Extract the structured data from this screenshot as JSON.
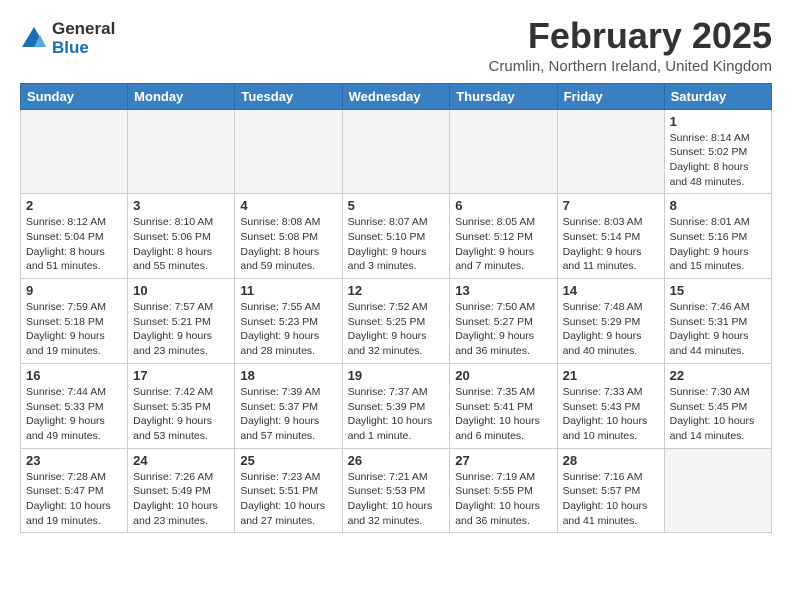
{
  "logo": {
    "general": "General",
    "blue": "Blue"
  },
  "title": "February 2025",
  "location": "Crumlin, Northern Ireland, United Kingdom",
  "days_of_week": [
    "Sunday",
    "Monday",
    "Tuesday",
    "Wednesday",
    "Thursday",
    "Friday",
    "Saturday"
  ],
  "weeks": [
    [
      {
        "num": "",
        "info": ""
      },
      {
        "num": "",
        "info": ""
      },
      {
        "num": "",
        "info": ""
      },
      {
        "num": "",
        "info": ""
      },
      {
        "num": "",
        "info": ""
      },
      {
        "num": "",
        "info": ""
      },
      {
        "num": "1",
        "info": "Sunrise: 8:14 AM\nSunset: 5:02 PM\nDaylight: 8 hours and 48 minutes."
      }
    ],
    [
      {
        "num": "2",
        "info": "Sunrise: 8:12 AM\nSunset: 5:04 PM\nDaylight: 8 hours and 51 minutes."
      },
      {
        "num": "3",
        "info": "Sunrise: 8:10 AM\nSunset: 5:06 PM\nDaylight: 8 hours and 55 minutes."
      },
      {
        "num": "4",
        "info": "Sunrise: 8:08 AM\nSunset: 5:08 PM\nDaylight: 8 hours and 59 minutes."
      },
      {
        "num": "5",
        "info": "Sunrise: 8:07 AM\nSunset: 5:10 PM\nDaylight: 9 hours and 3 minutes."
      },
      {
        "num": "6",
        "info": "Sunrise: 8:05 AM\nSunset: 5:12 PM\nDaylight: 9 hours and 7 minutes."
      },
      {
        "num": "7",
        "info": "Sunrise: 8:03 AM\nSunset: 5:14 PM\nDaylight: 9 hours and 11 minutes."
      },
      {
        "num": "8",
        "info": "Sunrise: 8:01 AM\nSunset: 5:16 PM\nDaylight: 9 hours and 15 minutes."
      }
    ],
    [
      {
        "num": "9",
        "info": "Sunrise: 7:59 AM\nSunset: 5:18 PM\nDaylight: 9 hours and 19 minutes."
      },
      {
        "num": "10",
        "info": "Sunrise: 7:57 AM\nSunset: 5:21 PM\nDaylight: 9 hours and 23 minutes."
      },
      {
        "num": "11",
        "info": "Sunrise: 7:55 AM\nSunset: 5:23 PM\nDaylight: 9 hours and 28 minutes."
      },
      {
        "num": "12",
        "info": "Sunrise: 7:52 AM\nSunset: 5:25 PM\nDaylight: 9 hours and 32 minutes."
      },
      {
        "num": "13",
        "info": "Sunrise: 7:50 AM\nSunset: 5:27 PM\nDaylight: 9 hours and 36 minutes."
      },
      {
        "num": "14",
        "info": "Sunrise: 7:48 AM\nSunset: 5:29 PM\nDaylight: 9 hours and 40 minutes."
      },
      {
        "num": "15",
        "info": "Sunrise: 7:46 AM\nSunset: 5:31 PM\nDaylight: 9 hours and 44 minutes."
      }
    ],
    [
      {
        "num": "16",
        "info": "Sunrise: 7:44 AM\nSunset: 5:33 PM\nDaylight: 9 hours and 49 minutes."
      },
      {
        "num": "17",
        "info": "Sunrise: 7:42 AM\nSunset: 5:35 PM\nDaylight: 9 hours and 53 minutes."
      },
      {
        "num": "18",
        "info": "Sunrise: 7:39 AM\nSunset: 5:37 PM\nDaylight: 9 hours and 57 minutes."
      },
      {
        "num": "19",
        "info": "Sunrise: 7:37 AM\nSunset: 5:39 PM\nDaylight: 10 hours and 1 minute."
      },
      {
        "num": "20",
        "info": "Sunrise: 7:35 AM\nSunset: 5:41 PM\nDaylight: 10 hours and 6 minutes."
      },
      {
        "num": "21",
        "info": "Sunrise: 7:33 AM\nSunset: 5:43 PM\nDaylight: 10 hours and 10 minutes."
      },
      {
        "num": "22",
        "info": "Sunrise: 7:30 AM\nSunset: 5:45 PM\nDaylight: 10 hours and 14 minutes."
      }
    ],
    [
      {
        "num": "23",
        "info": "Sunrise: 7:28 AM\nSunset: 5:47 PM\nDaylight: 10 hours and 19 minutes."
      },
      {
        "num": "24",
        "info": "Sunrise: 7:26 AM\nSunset: 5:49 PM\nDaylight: 10 hours and 23 minutes."
      },
      {
        "num": "25",
        "info": "Sunrise: 7:23 AM\nSunset: 5:51 PM\nDaylight: 10 hours and 27 minutes."
      },
      {
        "num": "26",
        "info": "Sunrise: 7:21 AM\nSunset: 5:53 PM\nDaylight: 10 hours and 32 minutes."
      },
      {
        "num": "27",
        "info": "Sunrise: 7:19 AM\nSunset: 5:55 PM\nDaylight: 10 hours and 36 minutes."
      },
      {
        "num": "28",
        "info": "Sunrise: 7:16 AM\nSunset: 5:57 PM\nDaylight: 10 hours and 41 minutes."
      },
      {
        "num": "",
        "info": ""
      }
    ]
  ]
}
